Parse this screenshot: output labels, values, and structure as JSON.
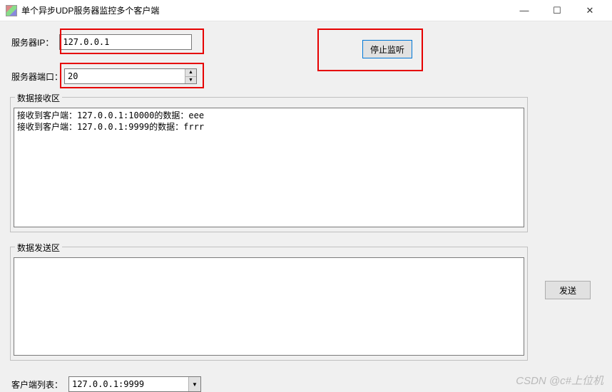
{
  "window": {
    "title": "单个异步UDP服务器监控多个客户端"
  },
  "server": {
    "ip_label": "服务器IP：",
    "ip_value": "127.0.0.1",
    "port_label": "服务器端口：",
    "port_value": "20"
  },
  "buttons": {
    "stop_listen": "停止监听",
    "send": "发送"
  },
  "recv": {
    "group_title": "数据接收区",
    "lines": [
      "接收到客户端：127.0.0.1:10000的数据：eee",
      "接收到客户端：127.0.0.1:9999的数据：frrr"
    ]
  },
  "send": {
    "group_title": "数据发送区",
    "content": ""
  },
  "clients": {
    "label": "客户端列表：",
    "selected": "127.0.0.1:9999"
  },
  "watermark": "CSDN @c#上位机"
}
